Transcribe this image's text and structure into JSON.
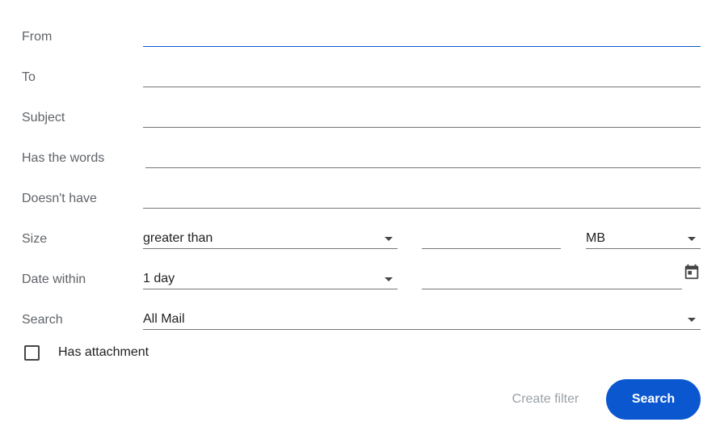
{
  "colors": {
    "accent": "#0b57d0",
    "label": "#5f6368",
    "underline": "#747775",
    "disabled": "#9aa0a6"
  },
  "fields": {
    "from": {
      "label": "From",
      "value": ""
    },
    "to": {
      "label": "To",
      "value": ""
    },
    "subject": {
      "label": "Subject",
      "value": ""
    },
    "has_words": {
      "label": "Has the words",
      "value": ""
    },
    "doesnt_have": {
      "label": "Doesn't have",
      "value": ""
    }
  },
  "size": {
    "label": "Size",
    "comparator": "greater than",
    "amount": "",
    "unit": "MB"
  },
  "date_within": {
    "label": "Date within",
    "range": "1 day",
    "date": "",
    "icon": "calendar-icon"
  },
  "search_scope": {
    "label": "Search",
    "value": "All Mail"
  },
  "attachment": {
    "label": "Has attachment",
    "checked": false
  },
  "actions": {
    "create_filter": "Create filter",
    "search": "Search"
  }
}
